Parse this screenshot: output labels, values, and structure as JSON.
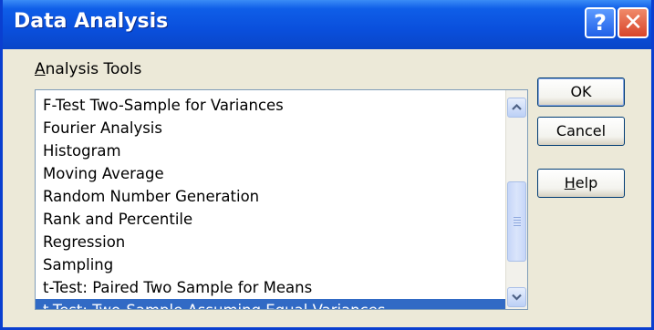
{
  "window": {
    "title": "Data Analysis",
    "help_glyph": "?",
    "close_glyph": "✕"
  },
  "group": {
    "label_accel": "A",
    "label_rest": "nalysis Tools"
  },
  "list": {
    "items": [
      "F-Test Two-Sample for Variances",
      "Fourier Analysis",
      "Histogram",
      "Moving Average",
      "Random Number Generation",
      "Rank and Percentile",
      "Regression",
      "Sampling",
      "t-Test: Paired Two Sample for Means",
      "t-Test: Two-Sample Assuming Equal Variances"
    ],
    "selected": "t-Test: Two-Sample Assuming Equal Variances"
  },
  "buttons": {
    "ok": "OK",
    "cancel": "Cancel",
    "help_accel": "H",
    "help_rest": "elp"
  },
  "colors": {
    "titlebar": "#0a4fdc",
    "selection": "#316ac5",
    "dialog_bg": "#ece9d8"
  },
  "icons": {
    "help": "question-mark-icon",
    "close": "close-x-icon",
    "scroll_up": "scroll-up-arrow-icon",
    "scroll_down": "scroll-down-arrow-icon"
  }
}
